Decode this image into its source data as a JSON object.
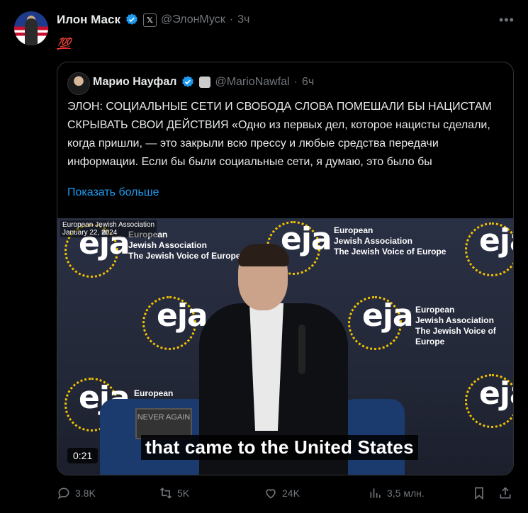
{
  "post": {
    "author_name": "Илон Маск",
    "handle": "@ЭлонМуск",
    "separator": "·",
    "time": "3ч",
    "text": "💯"
  },
  "quoted": {
    "author_name": "Марио Науфал",
    "handle": "@MarioNawfal",
    "separator": "·",
    "time": "6ч",
    "text": "ЭЛОН: СОЦИАЛЬНЫЕ СЕТИ И СВОБОДА СЛОВА ПОМЕШАЛИ БЫ НАЦИСТАМ СКРЫВАТЬ СВОИ ДЕЙСТВИЯ «Одно из первых дел, которое нацисты сделали, когда пришли, — это закрыли всю прессу и любые средства передачи информации. Если бы были социальные сети, я думаю, это было бы",
    "show_more": "Показать больше"
  },
  "video": {
    "watermark_line1": "European Jewish Association",
    "watermark_line2": "January 22, 2024",
    "caption": "that came to the United States",
    "duration": "0:21",
    "logo_text": "eja",
    "logo_line1": "European",
    "logo_line2": "Jewish Association",
    "logo_line3": "The Jewish Voice of Europe",
    "sign_text": "NEVER AGAIN"
  },
  "actions": {
    "replies": "3.8K",
    "reposts": "5K",
    "likes": "24K",
    "views": "3,5 млн."
  },
  "icons": [
    "verified-icon",
    "x-badge-icon",
    "more-icon",
    "reply-icon",
    "repost-icon",
    "like-icon",
    "views-icon",
    "bookmark-icon",
    "share-icon"
  ],
  "colors": {
    "background": "#000000",
    "accent": "#1d9bf0",
    "muted": "#71767b",
    "text": "#e7e9ea"
  }
}
